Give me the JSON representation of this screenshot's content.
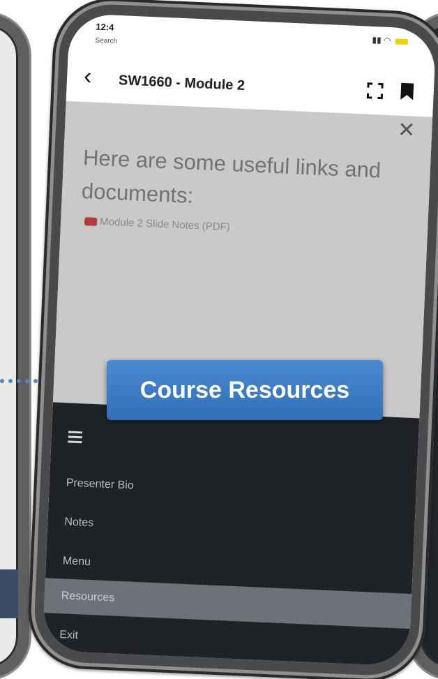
{
  "status_bar": {
    "time": "12:4",
    "back_app": "Search"
  },
  "header": {
    "title": "SW1660 - Module 2"
  },
  "content": {
    "heading": "Here are some useful links and documents:",
    "link": "Module 2 Slide Notes (PDF)"
  },
  "menu": {
    "items": [
      {
        "label": "Presenter Bio"
      },
      {
        "label": "Notes"
      },
      {
        "label": "Menu"
      },
      {
        "label": "Resources"
      },
      {
        "label": "Exit"
      }
    ],
    "active_item": "Resources"
  },
  "callout": {
    "label": "Course Resources"
  },
  "colors": {
    "accent": "#3a78c0",
    "menu_bg": "#1f2328",
    "content_bg": "#c9c9c9",
    "active_item_bg": "#6d7278",
    "pdf_icon": "#b83a3a"
  },
  "icons": [
    "back-arrow-icon",
    "expand-icon",
    "bookmark-icon",
    "close-icon",
    "pdf-icon",
    "hamburger-menu-icon"
  ]
}
